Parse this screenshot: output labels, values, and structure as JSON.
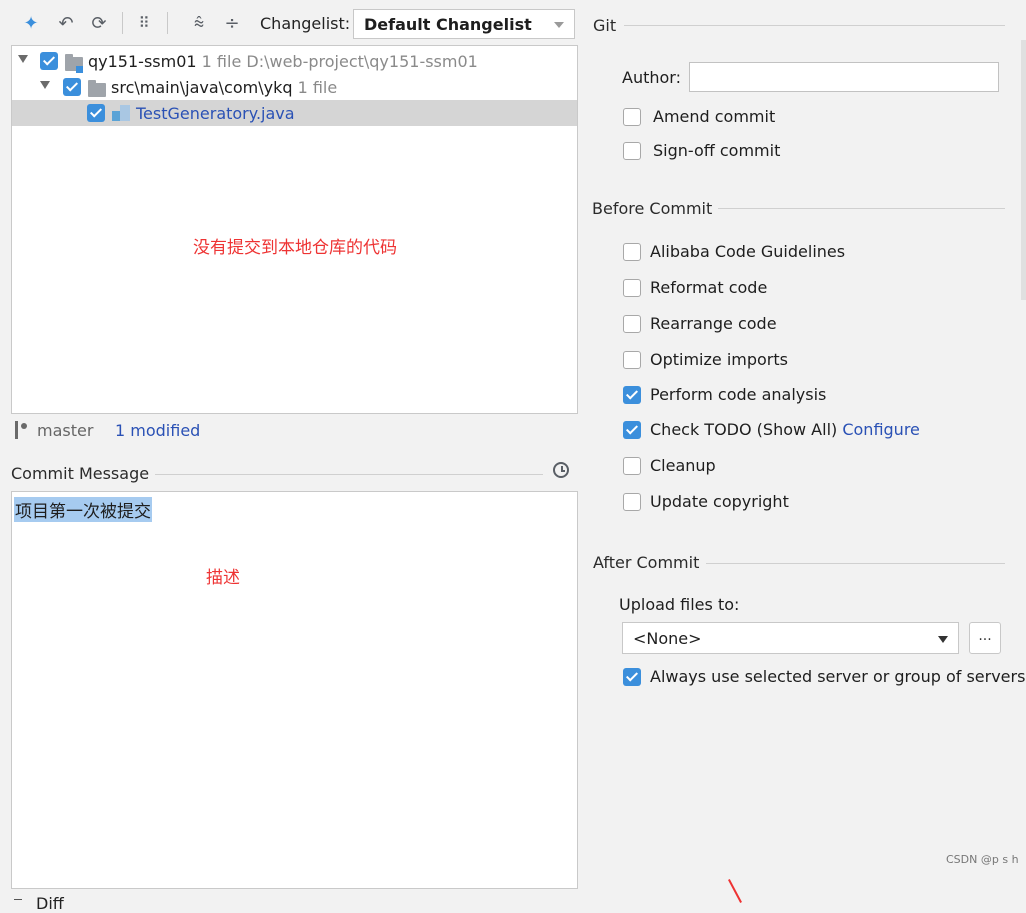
{
  "toolbar": {
    "changelist_label": "Changelist:",
    "changelist_value": "Default Changelist"
  },
  "tree": {
    "root": {
      "name": "qy151-ssm01",
      "count": "1 file",
      "path": "D:\\web-project\\qy151-ssm01"
    },
    "folder": {
      "name": "src\\main\\java\\com\\ykq",
      "count": "1 file"
    },
    "file": {
      "name": "TestGeneratory.java"
    }
  },
  "annotations": {
    "tree_note": "没有提交到本地仓库的代码",
    "message_note": "描述"
  },
  "status": {
    "branch": "master",
    "modified": "1 modified"
  },
  "commit_message": {
    "title": "Commit Message",
    "text": "项目第一次被提交"
  },
  "git": {
    "title": "Git",
    "author_label": "Author:",
    "author_value": "",
    "amend_commit": "Amend commit",
    "signoff_commit": "Sign-off commit"
  },
  "before_commit": {
    "title": "Before Commit",
    "options": [
      {
        "label": "Alibaba Code Guidelines",
        "checked": false
      },
      {
        "label": "Reformat code",
        "checked": false
      },
      {
        "label": "Rearrange code",
        "checked": false
      },
      {
        "label": "Optimize imports",
        "checked": false
      },
      {
        "label": "Perform code analysis",
        "checked": true
      },
      {
        "label": "Check TODO (Show All)",
        "checked": true
      },
      {
        "label": "Cleanup",
        "checked": false
      },
      {
        "label": "Update copyright",
        "checked": false
      }
    ],
    "configure_link": "Configure"
  },
  "after_commit": {
    "title": "After Commit",
    "upload_label": "Upload files to:",
    "upload_value": "<None>",
    "browse_label": "...",
    "always_use": "Always use selected server or group of servers"
  },
  "footer": {
    "diff_label": "Diff",
    "watermark": "CSDN @p s h"
  }
}
